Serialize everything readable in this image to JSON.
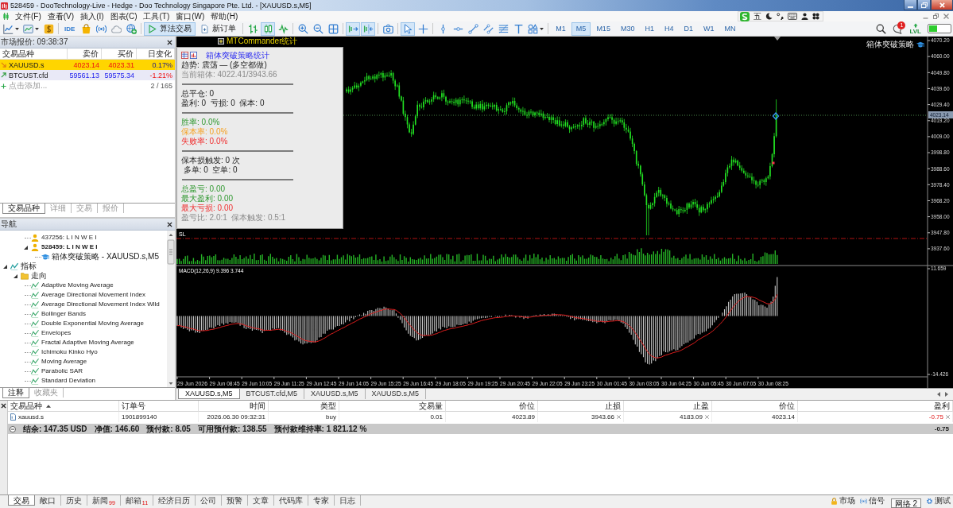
{
  "window": {
    "title": "528459 - DooTechnology-Live - Hedge - Doo Technology Singapore Pte. Ltd. - [XAUUSD.s,M5]"
  },
  "menu": [
    "文件(F)",
    "查看(V)",
    "插入(I)",
    "图表(C)",
    "工具(T)",
    "窗口(W)",
    "帮助(H)"
  ],
  "input_method_bar": {
    "mode": "五"
  },
  "toolbar": {
    "ide_label": "IDE",
    "algo_trading": {
      "label": "算法交易",
      "selected": true
    },
    "new_order": {
      "label": "新订单"
    },
    "chart_types": [
      {
        "selected": false
      },
      {
        "selected": true
      },
      {
        "selected": false
      }
    ],
    "scroll_toggles": [
      {
        "selected": true
      },
      {
        "selected": true
      }
    ],
    "pointer_tools": [
      {
        "selected": true
      },
      {
        "selected": false
      }
    ],
    "timeframes": [
      {
        "label": "M1",
        "selected": false
      },
      {
        "label": "M5",
        "selected": true
      },
      {
        "label": "M15",
        "selected": false
      },
      {
        "label": "M30",
        "selected": false
      },
      {
        "label": "H1",
        "selected": false
      },
      {
        "label": "H4",
        "selected": false
      },
      {
        "label": "D1",
        "selected": false
      },
      {
        "label": "W1",
        "selected": false
      },
      {
        "label": "MN",
        "selected": false
      }
    ],
    "notification_count": "1",
    "lvl_label": "LVL"
  },
  "market_watch": {
    "title": "市场报价: 09:38:37",
    "columns": [
      "交易品种",
      "卖价",
      "买价",
      "日变化"
    ],
    "rows": [
      {
        "symbol": "XAUUSD.s",
        "bid": "4023.14",
        "ask": "4023.31",
        "change": "0.17%",
        "uptick": false,
        "change_up": true,
        "selected": true
      },
      {
        "symbol": "BTCUST.cfd",
        "bid": "59561.13",
        "ask": "59575.34",
        "change": "-1.21%",
        "uptick": true,
        "change_up": false,
        "selected": false
      }
    ],
    "add_label": "点击添加...",
    "count": "2 / 165",
    "tabs": [
      {
        "label": "交易品种",
        "selected": true
      },
      {
        "label": "详细",
        "selected": false
      },
      {
        "label": "交易",
        "selected": false
      },
      {
        "label": "报价",
        "selected": false
      }
    ]
  },
  "navigator": {
    "title": "导航",
    "tree": [
      {
        "label": "437256: L I N W E I",
        "kind": "account",
        "current": false
      },
      {
        "label": "528459: L I N W E I",
        "kind": "account",
        "current": true,
        "expanded": true,
        "children": [
          {
            "label": "箱体突破策略 - XAUUSD.s,M5",
            "kind": "expert"
          }
        ]
      },
      {
        "label": "指标",
        "kind": "group",
        "expanded": true,
        "children": [
          {
            "label": "走向",
            "kind": "folder",
            "expanded": true,
            "children": [
              {
                "label": "Adaptive Moving Average",
                "kind": "indicator"
              },
              {
                "label": "Average Directional Movement Index",
                "kind": "indicator"
              },
              {
                "label": "Average Directional Movement Index Wild",
                "kind": "indicator"
              },
              {
                "label": "Bollinger Bands",
                "kind": "indicator"
              },
              {
                "label": "Double Exponential Moving Average",
                "kind": "indicator"
              },
              {
                "label": "Envelopes",
                "kind": "indicator"
              },
              {
                "label": "Fractal Adaptive Moving Average",
                "kind": "indicator"
              },
              {
                "label": "Ichimoku Kinko Hyo",
                "kind": "indicator"
              },
              {
                "label": "Moving Average",
                "kind": "indicator"
              },
              {
                "label": "Parabolic SAR",
                "kind": "indicator"
              },
              {
                "label": "Standard Deviation",
                "kind": "indicator"
              }
            ]
          }
        ]
      }
    ],
    "tabs": [
      {
        "label": "注释",
        "selected": true
      },
      {
        "label": "收藏夹",
        "selected": false
      }
    ]
  },
  "chart": {
    "overlay_label": "MTCommander统计",
    "stats_panel": {
      "title": "箱体突破策略统计",
      "sections": [
        [
          {
            "text": "趋势: 震荡 — (多空都做)",
            "kind": "normal"
          },
          {
            "text": "当前箱体: 4022.41/3943.66",
            "kind": "muted"
          }
        ],
        [
          {
            "text": "总平仓: 0",
            "kind": "normal"
          },
          {
            "text": "盈利: 0  亏损: 0  保本: 0",
            "kind": "normal"
          }
        ],
        [
          {
            "text": "胜率: 0.0%",
            "kind": "positive"
          },
          {
            "text": "保本率: 0.0%",
            "kind": "caution"
          },
          {
            "text": "失败率: 0.0%",
            "kind": "negative"
          }
        ],
        [
          {
            "text": "保本损触发: 0 次",
            "kind": "normal"
          },
          {
            "text": " 多单: 0  空单: 0",
            "kind": "normal"
          }
        ],
        [
          {
            "text": "总盈亏: 0.00",
            "kind": "positive"
          },
          {
            "text": "最大盈利: 0.00",
            "kind": "positive"
          },
          {
            "text": "最大亏损: 0.00",
            "kind": "negative"
          },
          {
            "text": "盈亏比: 2.0:1  保本触发: 0.5:1",
            "kind": "muted"
          }
        ]
      ]
    },
    "expert_label": "箱体突破策略",
    "price_axis": [
      "4070.20",
      "4060.00",
      "4049.80",
      "4039.60",
      "4029.40",
      "4019.20",
      "4009.00",
      "3998.80",
      "3988.60",
      "3978.40",
      "3968.20",
      "3958.00",
      "3947.80",
      "3937.60"
    ],
    "current_price": "4023.14",
    "stop_loss_label": "SL",
    "indicator_label": "MACD(12,26,9) 9.396 3.744",
    "indicator_axis": [
      "11.659",
      "-14.426"
    ],
    "time_axis": [
      "29 Jun 2026",
      "29 Jun 08:45",
      "29 Jun 10:05",
      "29 Jun 11:25",
      "29 Jun 12:45",
      "29 Jun 14:05",
      "29 Jun 15:25",
      "29 Jun 16:45",
      "29 Jun 18:05",
      "29 Jun 19:25",
      "29 Jun 20:45",
      "29 Jun 22:05",
      "29 Jun 23:25",
      "30 Jun 01:45",
      "30 Jun 03:05",
      "30 Jun 04:25",
      "30 Jun 05:45",
      "30 Jun 07:05",
      "30 Jun 08:25"
    ]
  },
  "chart_tabs": [
    {
      "label": "XAUUSD.s,M5",
      "selected": true
    },
    {
      "label": "BTCUST.cfd,M5",
      "selected": false
    },
    {
      "label": "XAUUSD.s,M5",
      "selected": false
    },
    {
      "label": "XAUUSD.s,M5",
      "selected": false
    }
  ],
  "toolbox": {
    "columns": [
      {
        "label": "交易品种",
        "sorted": true
      },
      {
        "label": "订单号",
        "sorted": false
      },
      {
        "label": "时间",
        "sorted": false
      },
      {
        "label": "类型",
        "sorted": false
      },
      {
        "label": "交易量",
        "sorted": false
      },
      {
        "label": "价位",
        "sorted": false
      },
      {
        "label": "止损",
        "sorted": false
      },
      {
        "label": "止盈",
        "sorted": false
      },
      {
        "label": "价位",
        "sorted": false
      },
      {
        "label": "盈利",
        "sorted": false
      }
    ],
    "positions": [
      {
        "symbol": "xauusd.s",
        "ticket": "1901899140",
        "time": "2026.06.30 09:32:31",
        "type": "buy",
        "volume": "0.01",
        "open_price": "4023.89",
        "stop_loss": "3943.66",
        "take_profit": "4183.09",
        "price": "4023.14",
        "profit": "-0.75",
        "loss": true
      }
    ],
    "summary": {
      "expanded": true,
      "items": [
        "结余: 147.35 USD",
        "净值: 146.60",
        "预付款: 8.05",
        "可用预付款: 138.55",
        "预付款维持率: 1 821.12 %"
      ],
      "profit": "-0.75"
    },
    "tabs": [
      {
        "label": "交易",
        "selected": true
      },
      {
        "label": "敞口",
        "selected": false
      },
      {
        "label": "历史",
        "selected": false
      },
      {
        "label": "新闻",
        "badge": "99",
        "selected": false
      },
      {
        "label": "邮箱",
        "badge": "11",
        "selected": false
      },
      {
        "label": "经济日历",
        "selected": false
      },
      {
        "label": "公司",
        "selected": false
      },
      {
        "label": "预警",
        "selected": false
      },
      {
        "label": "文章",
        "selected": false
      },
      {
        "label": "代码库",
        "selected": false
      },
      {
        "label": "专家",
        "selected": false
      },
      {
        "label": "日志",
        "selected": false
      }
    ],
    "status": [
      {
        "label": "市场",
        "kind": "market"
      },
      {
        "label": "信号",
        "kind": "signals"
      },
      {
        "label": "测试",
        "kind": "tester"
      }
    ],
    "tooltip": "网络 2"
  }
}
